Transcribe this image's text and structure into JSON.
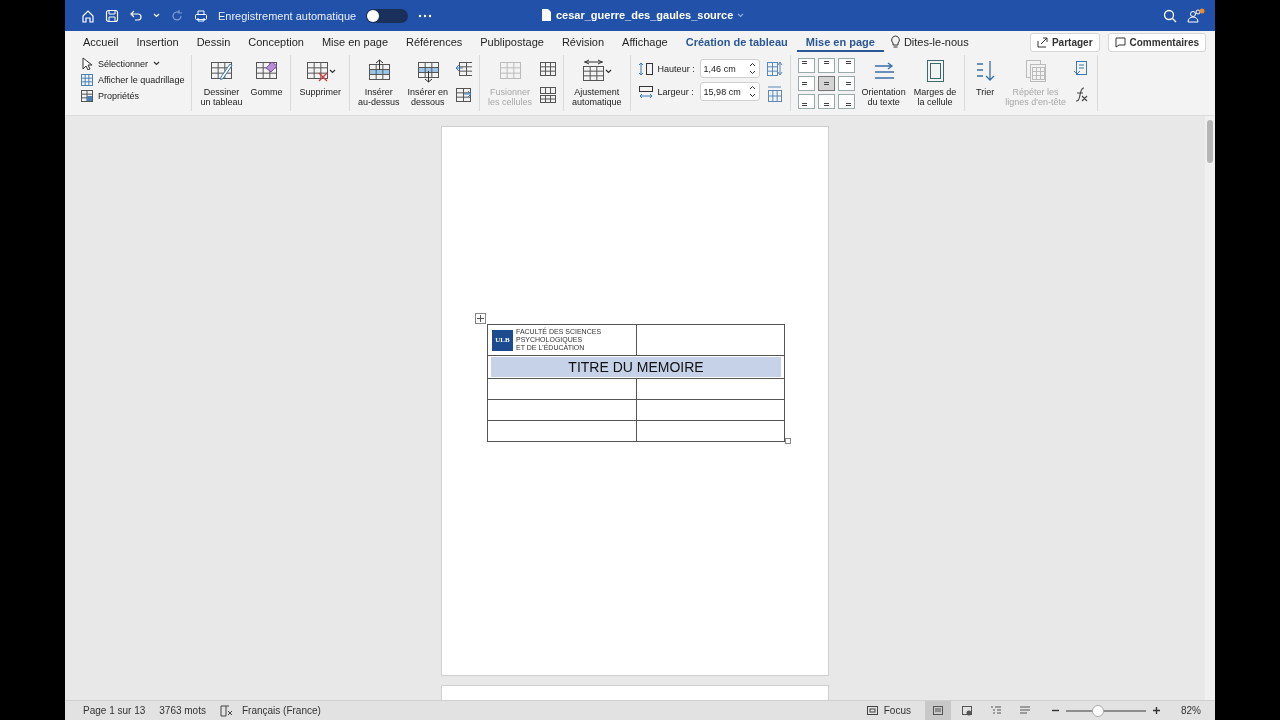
{
  "title_bar": {
    "autosave_label": "Enregistrement automatique",
    "autosave_on": false,
    "document_title": "cesar_guerre_des_gaules_source"
  },
  "menu": {
    "tabs": [
      {
        "label": "Accueil",
        "kind": "standard",
        "selected": false
      },
      {
        "label": "Insertion",
        "kind": "standard",
        "selected": false
      },
      {
        "label": "Dessin",
        "kind": "standard",
        "selected": false
      },
      {
        "label": "Conception",
        "kind": "standard",
        "selected": false
      },
      {
        "label": "Mise en page",
        "kind": "standard",
        "selected": false
      },
      {
        "label": "Références",
        "kind": "standard",
        "selected": false
      },
      {
        "label": "Publipostage",
        "kind": "standard",
        "selected": false
      },
      {
        "label": "Révision",
        "kind": "standard",
        "selected": false
      },
      {
        "label": "Affichage",
        "kind": "standard",
        "selected": false
      },
      {
        "label": "Création de tableau",
        "kind": "contextual",
        "selected": false
      },
      {
        "label": "Mise en page",
        "kind": "contextual",
        "selected": true
      }
    ],
    "tell_me": "Dites-le-nous",
    "share": "Partager",
    "comments": "Commentaires"
  },
  "ribbon": {
    "groups": [
      {
        "items": [
          {
            "kind": "small",
            "label": "Sélectionner",
            "dropdown": true,
            "disabled": false
          },
          {
            "kind": "small",
            "label": "Afficher le quadrillage",
            "dropdown": false,
            "disabled": false
          },
          {
            "kind": "small",
            "label": "Propriétés",
            "dropdown": false,
            "disabled": false
          }
        ]
      },
      {
        "items": [
          {
            "kind": "large",
            "label": "Dessiner\nun tableau",
            "dropdown": false,
            "disabled": false
          },
          {
            "kind": "large",
            "label": "Gomme",
            "dropdown": false,
            "disabled": false
          }
        ]
      },
      {
        "items": [
          {
            "kind": "large",
            "label": "Supprimer",
            "dropdown": true,
            "disabled": false
          }
        ]
      },
      {
        "items": [
          {
            "kind": "large",
            "label": "Insérer\nau-dessus",
            "dropdown": false,
            "disabled": false
          },
          {
            "kind": "large",
            "label": "Insérer en\ndessous",
            "dropdown": false,
            "disabled": false
          },
          {
            "kind": "icon_pair"
          }
        ]
      },
      {
        "items": [
          {
            "kind": "large",
            "label": "Fusionner\nles cellules",
            "dropdown": false,
            "disabled": true
          },
          {
            "kind": "icon_pair"
          }
        ]
      },
      {
        "items": [
          {
            "kind": "large",
            "label": "Ajustement\nautomatique",
            "dropdown": true,
            "disabled": false
          }
        ]
      },
      {
        "items": [
          {
            "kind": "fields",
            "fields": [
              {
                "label": "Hauteur :",
                "value": "1,46 cm"
              },
              {
                "label": "Largeur :",
                "value": "15,98 cm"
              }
            ]
          },
          {
            "kind": "icon_pair"
          }
        ]
      },
      {
        "items": [
          {
            "kind": "align_grid",
            "cells": [
              {
                "selected": false
              },
              {
                "selected": false
              },
              {
                "selected": false
              },
              {
                "selected": false
              },
              {
                "selected": true
              },
              {
                "selected": false
              },
              {
                "selected": false
              },
              {
                "selected": false
              },
              {
                "selected": false
              }
            ]
          },
          {
            "kind": "large",
            "label": "Orientation\ndu texte",
            "dropdown": false,
            "disabled": false
          },
          {
            "kind": "large",
            "label": "Marges de\nla cellule",
            "dropdown": false,
            "disabled": false
          }
        ]
      },
      {
        "items": [
          {
            "kind": "large",
            "label": "Trier",
            "dropdown": false,
            "disabled": false
          },
          {
            "kind": "large",
            "label": "Répéter les\nlignes d'en-tête",
            "dropdown": false,
            "disabled": true
          },
          {
            "kind": "icon_pair"
          }
        ]
      }
    ]
  },
  "document": {
    "table": {
      "rows": [
        {
          "kind": "logo",
          "logo": "ULB",
          "lines": [
            "FACULTÉ DES SCIENCES",
            "PSYCHOLOGIQUES",
            "ET DE L'ÉDUCATION"
          ]
        },
        {
          "kind": "title",
          "text": "TITRE DU MEMOIRE",
          "highlighted": true
        },
        {
          "kind": "empty"
        },
        {
          "kind": "empty"
        },
        {
          "kind": "empty"
        }
      ]
    }
  },
  "status_bar": {
    "page": "Page 1 sur 13",
    "words": "3763 mots",
    "language": "Français (France)",
    "focus": "Focus",
    "views": [
      {
        "selected": true
      },
      {
        "selected": false
      },
      {
        "selected": false
      },
      {
        "selected": false
      }
    ],
    "zoom": {
      "level": 0.4,
      "reading": "82%"
    }
  }
}
